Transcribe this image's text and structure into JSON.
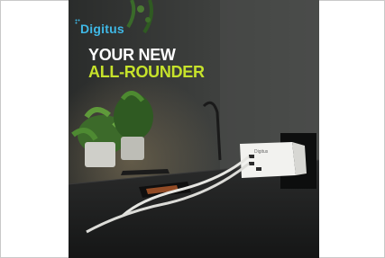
{
  "ad": {
    "brand": "Digitus",
    "headline_line1": "YOUR NEW",
    "headline_line2": "ALL-ROUNDER",
    "device_label": "Digitus"
  },
  "colors": {
    "accent_green": "#c6e22b",
    "brand_blue": "#3fb8e6",
    "wall": "#3a3c3a",
    "desk": "#1c1d1d"
  }
}
